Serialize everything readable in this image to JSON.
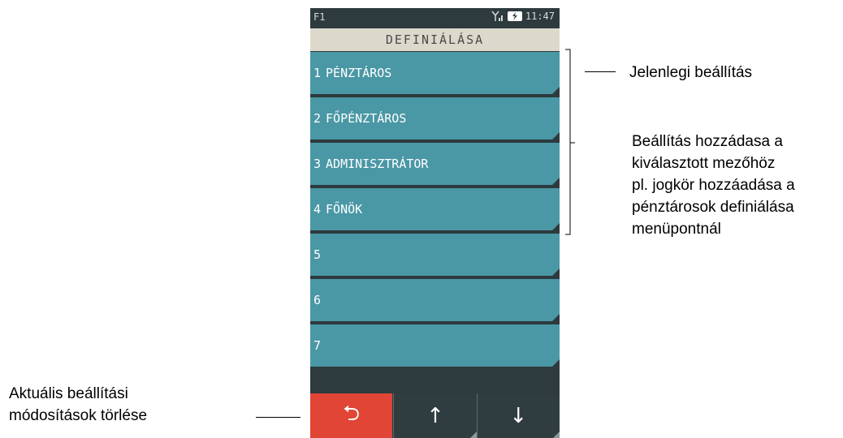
{
  "status": {
    "left": "F1",
    "time": "11:47"
  },
  "screen_title": "DEFINIÁLÁSA",
  "list_items": [
    {
      "num": "1",
      "label": "PÉNZTÁROS"
    },
    {
      "num": "2",
      "label": "FŐPÉNZTÁROS"
    },
    {
      "num": "3",
      "label": "ADMINISZTRÁTOR"
    },
    {
      "num": "4",
      "label": "FŐNÖK"
    },
    {
      "num": "5",
      "label": ""
    },
    {
      "num": "6",
      "label": ""
    },
    {
      "num": "7",
      "label": ""
    }
  ],
  "bottom_buttons": {
    "back": "⮌",
    "up": "↑",
    "down": "↓"
  },
  "annotations": {
    "current_setting": "Jelenlegi beállítás",
    "add_setting": [
      "Beállítás hozzádasa a",
      "kiválasztott mezőhöz",
      "pl. jogkör hozzáadása a",
      "pénztárosok definiálása",
      "menüpontnál"
    ],
    "clear_changes": [
      "Aktuális beállítási",
      "módosítások törlése"
    ]
  },
  "colors": {
    "back_button": "#e04535",
    "list_item": "#4a97a5",
    "title_bar": "#dcd9cc",
    "background": "#2d3a3e"
  }
}
